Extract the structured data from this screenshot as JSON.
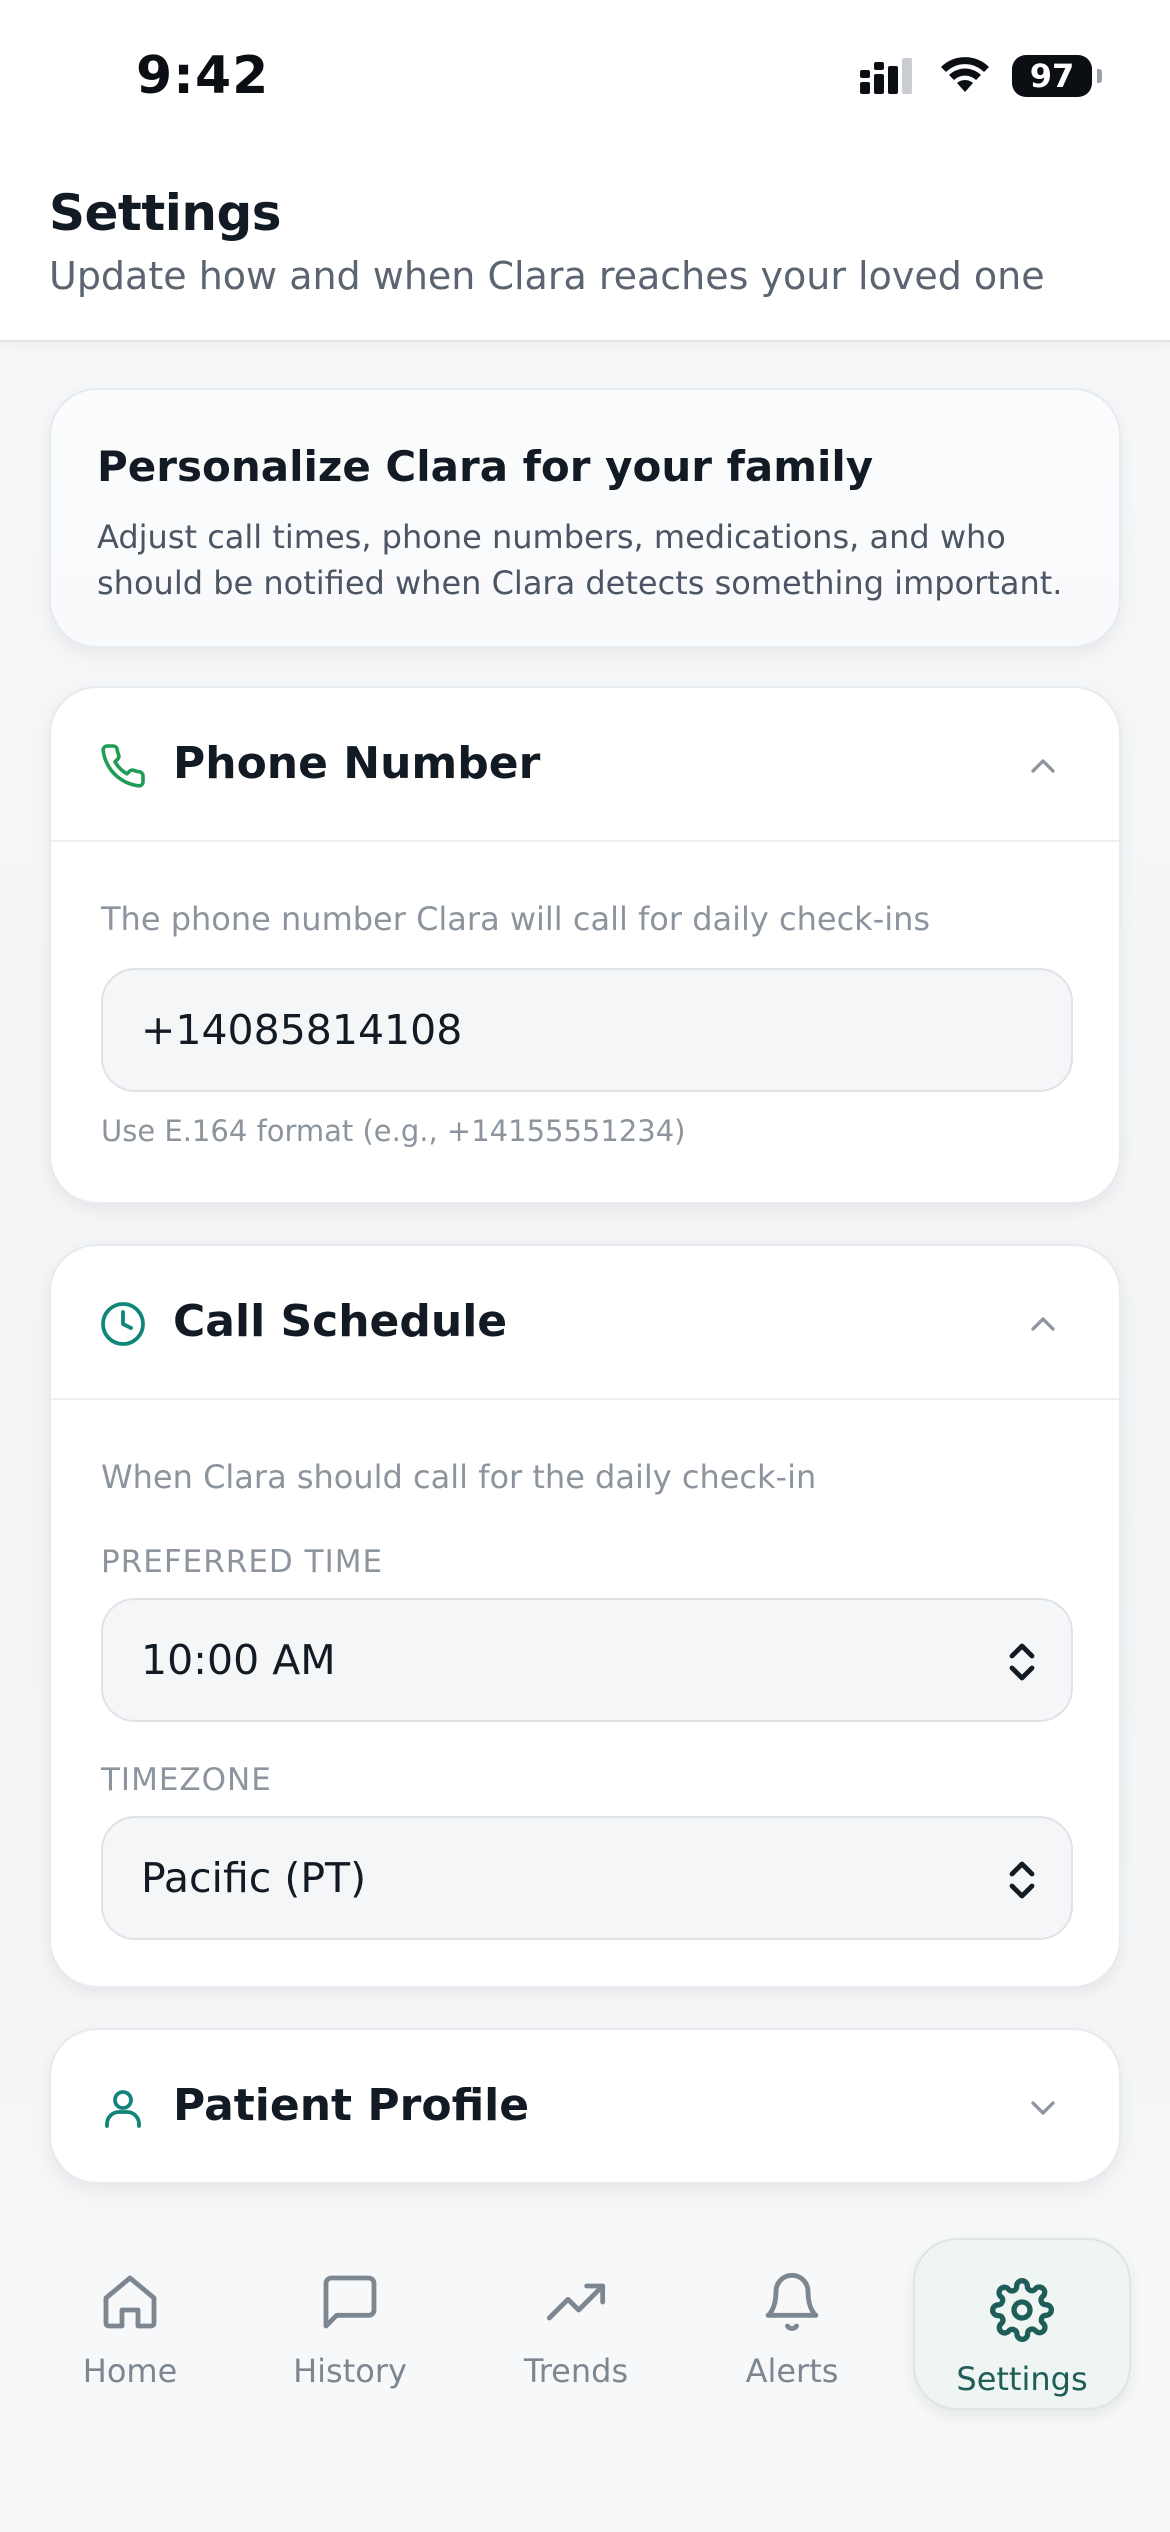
{
  "status_bar": {
    "time": "9:42",
    "battery": "97"
  },
  "header": {
    "title": "Settings",
    "subtitle": "Update how and when Clara reaches your loved one"
  },
  "intro": {
    "title": "Personalize Clara for your family",
    "body": "Adjust call times, phone numbers, medications, and who should be notified when Clara detects something important."
  },
  "phone_section": {
    "title": "Phone Number",
    "description": "The phone number Clara will call for daily check-ins",
    "value": "+14085814108",
    "hint": "Use E.164 format (e.g., +14155551234)"
  },
  "schedule_section": {
    "title": "Call Schedule",
    "description": "When Clara should call for the daily check-in",
    "time_label": "PREFERRED TIME",
    "time_value": "10:00 AM",
    "tz_label": "TIMEZONE",
    "tz_value": "Pacific (PT)"
  },
  "patient_section": {
    "title": "Patient Profile"
  },
  "nav": {
    "items": [
      {
        "label": "Home"
      },
      {
        "label": "History"
      },
      {
        "label": "Trends"
      },
      {
        "label": "Alerts"
      },
      {
        "label": "Settings"
      }
    ]
  },
  "colors": {
    "accent_green": "#1f9d55",
    "accent_teal": "#12857a",
    "active_nav": "#1f5e58"
  }
}
